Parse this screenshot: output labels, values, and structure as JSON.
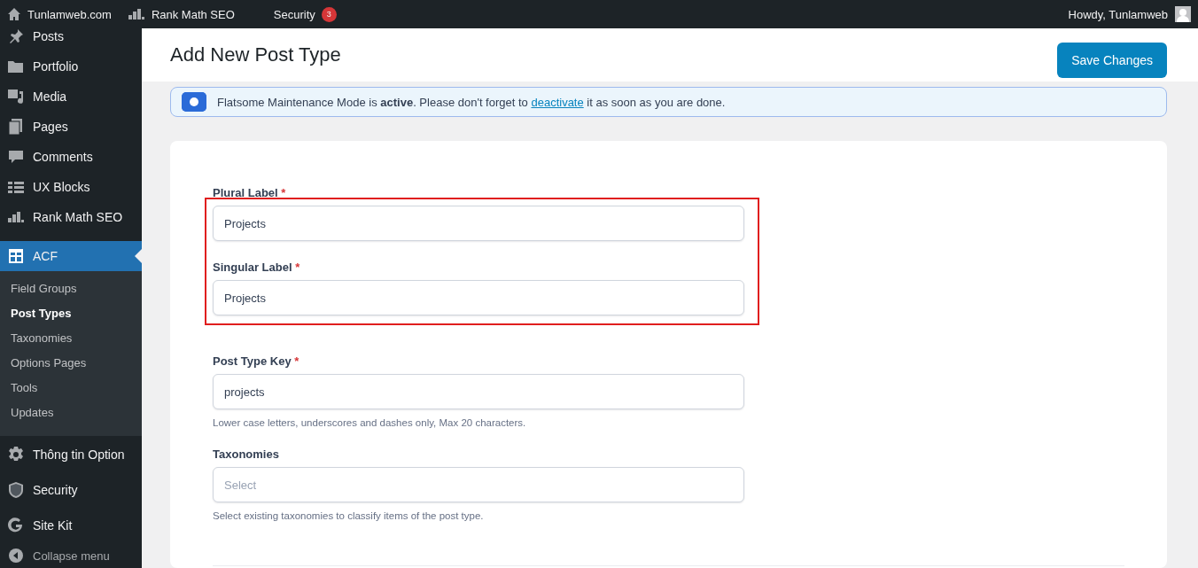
{
  "admin_bar": {
    "items": [
      {
        "kind": "home",
        "label": "Tunlamweb.com"
      },
      {
        "kind": "chart",
        "label": "Rank Math SEO"
      },
      {
        "kind": "none",
        "label": "Security",
        "badge": "3"
      }
    ],
    "account": "Howdy, Tunlamweb"
  },
  "sidebar": {
    "items": [
      {
        "label": "Posts",
        "selected": false
      },
      {
        "label": "Portfolio",
        "selected": false
      },
      {
        "label": "Media",
        "selected": false
      },
      {
        "label": "Pages",
        "selected": false
      },
      {
        "label": "Comments",
        "selected": false
      },
      {
        "label": "UX Blocks",
        "selected": false
      },
      {
        "label": "Rank Math SEO",
        "selected": false
      },
      {
        "label": "ACF",
        "selected": true,
        "children": [
          {
            "label": "Field Groups",
            "selected": false
          },
          {
            "label": "Post Types",
            "selected": true
          },
          {
            "label": "Taxonomies",
            "selected": false
          },
          {
            "label": "Options Pages",
            "selected": false
          },
          {
            "label": "Tools",
            "selected": false
          },
          {
            "label": "Updates",
            "selected": false
          }
        ]
      },
      {
        "label": "Thông tin Option",
        "selected": false
      },
      {
        "label": "Security",
        "selected": false
      },
      {
        "label": "Site Kit",
        "selected": false
      },
      {
        "label": "Collapse menu",
        "selected": false
      }
    ]
  },
  "header": {
    "title": "Add New Post Type",
    "save_button": "Save Changes"
  },
  "notice": {
    "before": "Flatsome Maintenance Mode is ",
    "bold": "active",
    "middle": ". Please don't forget to ",
    "link": "deactivate",
    "after": " it as soon as you are done."
  },
  "form": {
    "groups": [
      {
        "highlighted": true,
        "fields": [
          {
            "label": "Plural Label",
            "required_mark": "*",
            "value": "Projects"
          },
          {
            "label": "Singular Label",
            "required_mark": "*",
            "value": "Projects"
          }
        ]
      },
      {
        "highlighted": false,
        "fields": [
          {
            "label": "Post Type Key",
            "required_mark": "*",
            "value": "projects",
            "help": "Lower case letters, underscores and dashes only, Max 20 characters."
          },
          {
            "label": "Taxonomies",
            "placeholder": "Select",
            "help": "Select existing taxonomies to classify items of the post type."
          }
        ]
      }
    ]
  }
}
